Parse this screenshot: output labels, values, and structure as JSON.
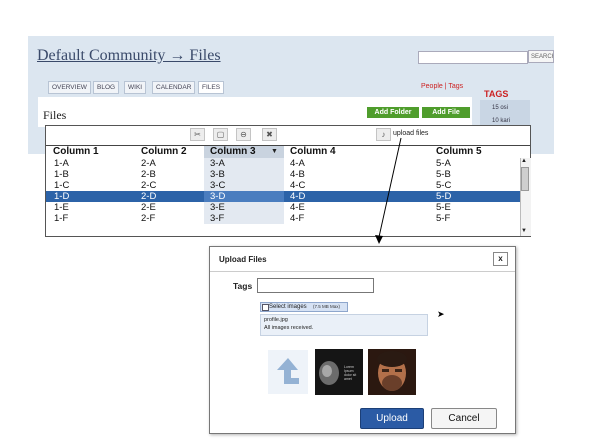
{
  "community": {
    "title": "Default Community → Files",
    "search_button": "SEARCH",
    "tabs": [
      "OVERVIEW",
      "BLOG",
      "WIKI",
      "CALENDAR",
      "FILES"
    ],
    "people_tags": "People | Tags"
  },
  "tags_sidebar": {
    "heading": "TAGS",
    "items": [
      "15  osi",
      "10  kari"
    ]
  },
  "files": {
    "heading": "Files",
    "add_folder": "Add Folder",
    "add_file": "Add File"
  },
  "toolbar": {
    "upload_label": "upload files",
    "icons": [
      "scissors-icon",
      "copy-icon",
      "link-icon",
      "delete-icon",
      "upload-icon"
    ]
  },
  "grid": {
    "columns": [
      "Column 1",
      "Column 2",
      "Column 3",
      "Column 4",
      "Column 5"
    ],
    "sorted_column": "Column 3",
    "selected_row": "1-D",
    "rows": [
      [
        "1-A",
        "2-A",
        "3-A",
        "4-A",
        "5-A"
      ],
      [
        "1-B",
        "2-B",
        "3-B",
        "4-B",
        "5-B"
      ],
      [
        "1-C",
        "2-C",
        "3-C",
        "4-C",
        "5-C"
      ],
      [
        "1-D",
        "2-D",
        "3-D",
        "4-D",
        "5-D"
      ],
      [
        "1-E",
        "2-E",
        "3-E",
        "4-E",
        "5-E"
      ],
      [
        "1-F",
        "2-F",
        "3-F",
        "4-F",
        "5-F"
      ]
    ]
  },
  "dialog": {
    "title": "Upload Files",
    "close": "x",
    "tags_label": "Tags",
    "tags_value": "",
    "select_label": "Select images",
    "select_size": "(7.5 MB Max)",
    "file_name": "profile.jpg",
    "file_status": "All images received.",
    "thumb_text": "Lorem Ipsum dolor sit amet",
    "upload": "Upload",
    "cancel": "Cancel"
  },
  "colors": {
    "selection": "#2c63a8",
    "upload_button": "#2b5ba5",
    "add_button": "#4f9d2c",
    "tags_heading": "#cc2222"
  }
}
